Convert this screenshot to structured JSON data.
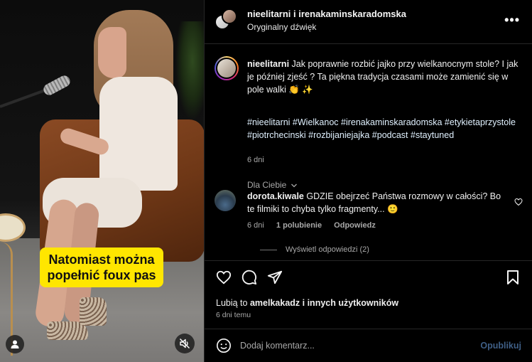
{
  "video": {
    "caption_line1": "Natomiast można",
    "caption_line2": "popełnić foux pas",
    "user_icon": "user-icon",
    "mute_icon": "speaker-muted-icon"
  },
  "post": {
    "header": {
      "names": "nieelitarni i irenakaminskaradomska",
      "audio": "Oryginalny dźwięk",
      "more": "•••"
    },
    "caption": {
      "author": "nieelitarni",
      "text": "Jak poprawnie rozbić jajko przy wielkanocnym stole? I jak je później zjeść ? Ta piękna tradycja czasami może zamienić się w pole walki 👏 ✨",
      "hashtags": "#nieelitarni #Wielkanoc #irenakaminskaradomska #etykietaprzystole #piotrchecinski #rozbijaniejajka #podcast #staytuned",
      "time": "6 dni",
      "translate": "Dla Ciebie"
    },
    "comment": {
      "author": "dorota.kiwale",
      "text": "GDZIE obejrzeć Państwa rozmowy w całości? Bo te filmiki to chyba tylko fragmenty... 🙂",
      "time": "6 dni",
      "likes": "1 polubienie",
      "reply": "Odpowiedz",
      "view_replies": "Wyświetl odpowiedzi (2)"
    },
    "actions": {
      "likes_prefix": "Lubią to",
      "likes_user": "amelkakadz",
      "likes_suffix": "i innych użytkowników",
      "posted_ago": "6 dni temu"
    },
    "composer": {
      "placeholder": "Dodaj komentarz...",
      "post_label": "Opublikuj"
    }
  },
  "colors": {
    "caption_bg": "#ffe600",
    "post_button": "#3f5f86",
    "muted_text": "#a8a8a8"
  }
}
